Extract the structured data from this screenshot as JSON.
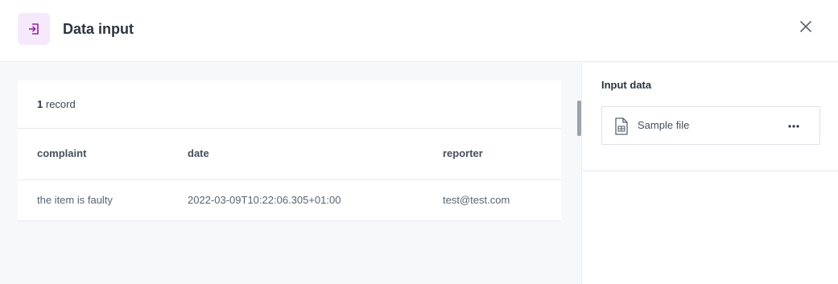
{
  "header": {
    "title": "Data input",
    "icon": "sign-in-icon",
    "close_icon": "close-icon",
    "accent_color": "#8e24aa"
  },
  "records": {
    "count": "1",
    "count_suffix": "record",
    "columns": [
      "complaint",
      "date",
      "reporter"
    ],
    "rows": [
      [
        "the item is faulty",
        "2022-03-09T10:22:06.305+01:00",
        "test@test.com"
      ]
    ]
  },
  "side_panel": {
    "title": "Input data",
    "file": {
      "label": "Sample file",
      "icon": "spreadsheet-file-icon",
      "menu_icon": "more-horizontal-icon"
    }
  }
}
